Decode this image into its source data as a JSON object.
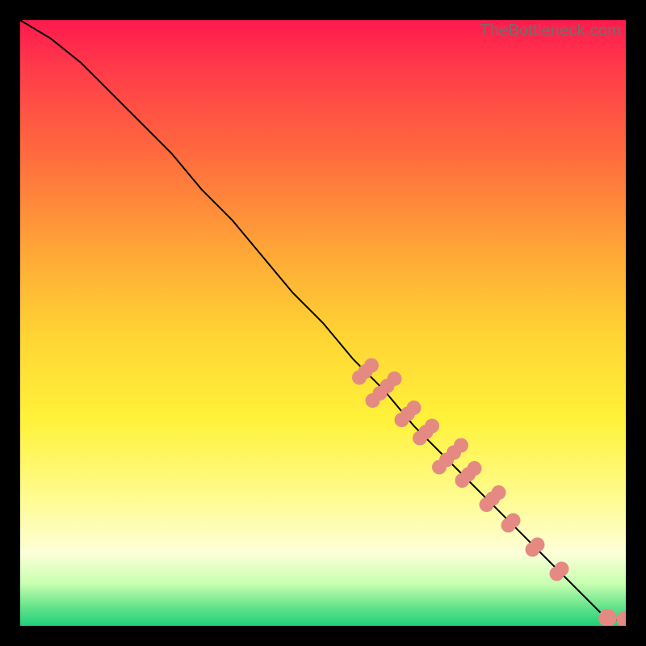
{
  "watermark": "TheBottleneck.com",
  "chart_data": {
    "type": "line",
    "title": "",
    "xlabel": "",
    "ylabel": "",
    "xlim": [
      0,
      100
    ],
    "ylim": [
      0,
      100
    ],
    "curve": {
      "x": [
        0,
        5,
        10,
        15,
        20,
        25,
        30,
        35,
        40,
        45,
        50,
        55,
        60,
        65,
        70,
        75,
        80,
        85,
        90,
        94,
        96,
        98,
        100
      ],
      "y": [
        100,
        97,
        93,
        88,
        83,
        78,
        72,
        67,
        61,
        55,
        50,
        44,
        39,
        33,
        28,
        23,
        18,
        13,
        8,
        4,
        2,
        1,
        1
      ]
    },
    "point_clusters": [
      {
        "cx": 57,
        "cy": 42,
        "r": 1.2,
        "n": 3,
        "spread": 1.0
      },
      {
        "cx": 60,
        "cy": 39,
        "r": 1.2,
        "n": 4,
        "spread": 1.2
      },
      {
        "cx": 64,
        "cy": 35,
        "r": 1.2,
        "n": 3,
        "spread": 1.0
      },
      {
        "cx": 67,
        "cy": 32,
        "r": 1.2,
        "n": 3,
        "spread": 1.0
      },
      {
        "cx": 71,
        "cy": 28,
        "r": 1.2,
        "n": 4,
        "spread": 1.2
      },
      {
        "cx": 74,
        "cy": 25,
        "r": 1.2,
        "n": 3,
        "spread": 1.0
      },
      {
        "cx": 78,
        "cy": 21,
        "r": 1.2,
        "n": 3,
        "spread": 1.0
      },
      {
        "cx": 81,
        "cy": 17,
        "r": 1.2,
        "n": 2,
        "spread": 0.8
      },
      {
        "cx": 85,
        "cy": 13,
        "r": 1.2,
        "n": 2,
        "spread": 0.8
      },
      {
        "cx": 89,
        "cy": 9,
        "r": 1.2,
        "n": 2,
        "spread": 0.8
      }
    ],
    "end_points": [
      {
        "cx": 97,
        "cy": 1.3,
        "r": 1.5
      },
      {
        "cx": 100,
        "cy": 1.0,
        "r": 1.5
      }
    ],
    "colors": {
      "curve": "#000000",
      "points": "#e58a82"
    }
  }
}
